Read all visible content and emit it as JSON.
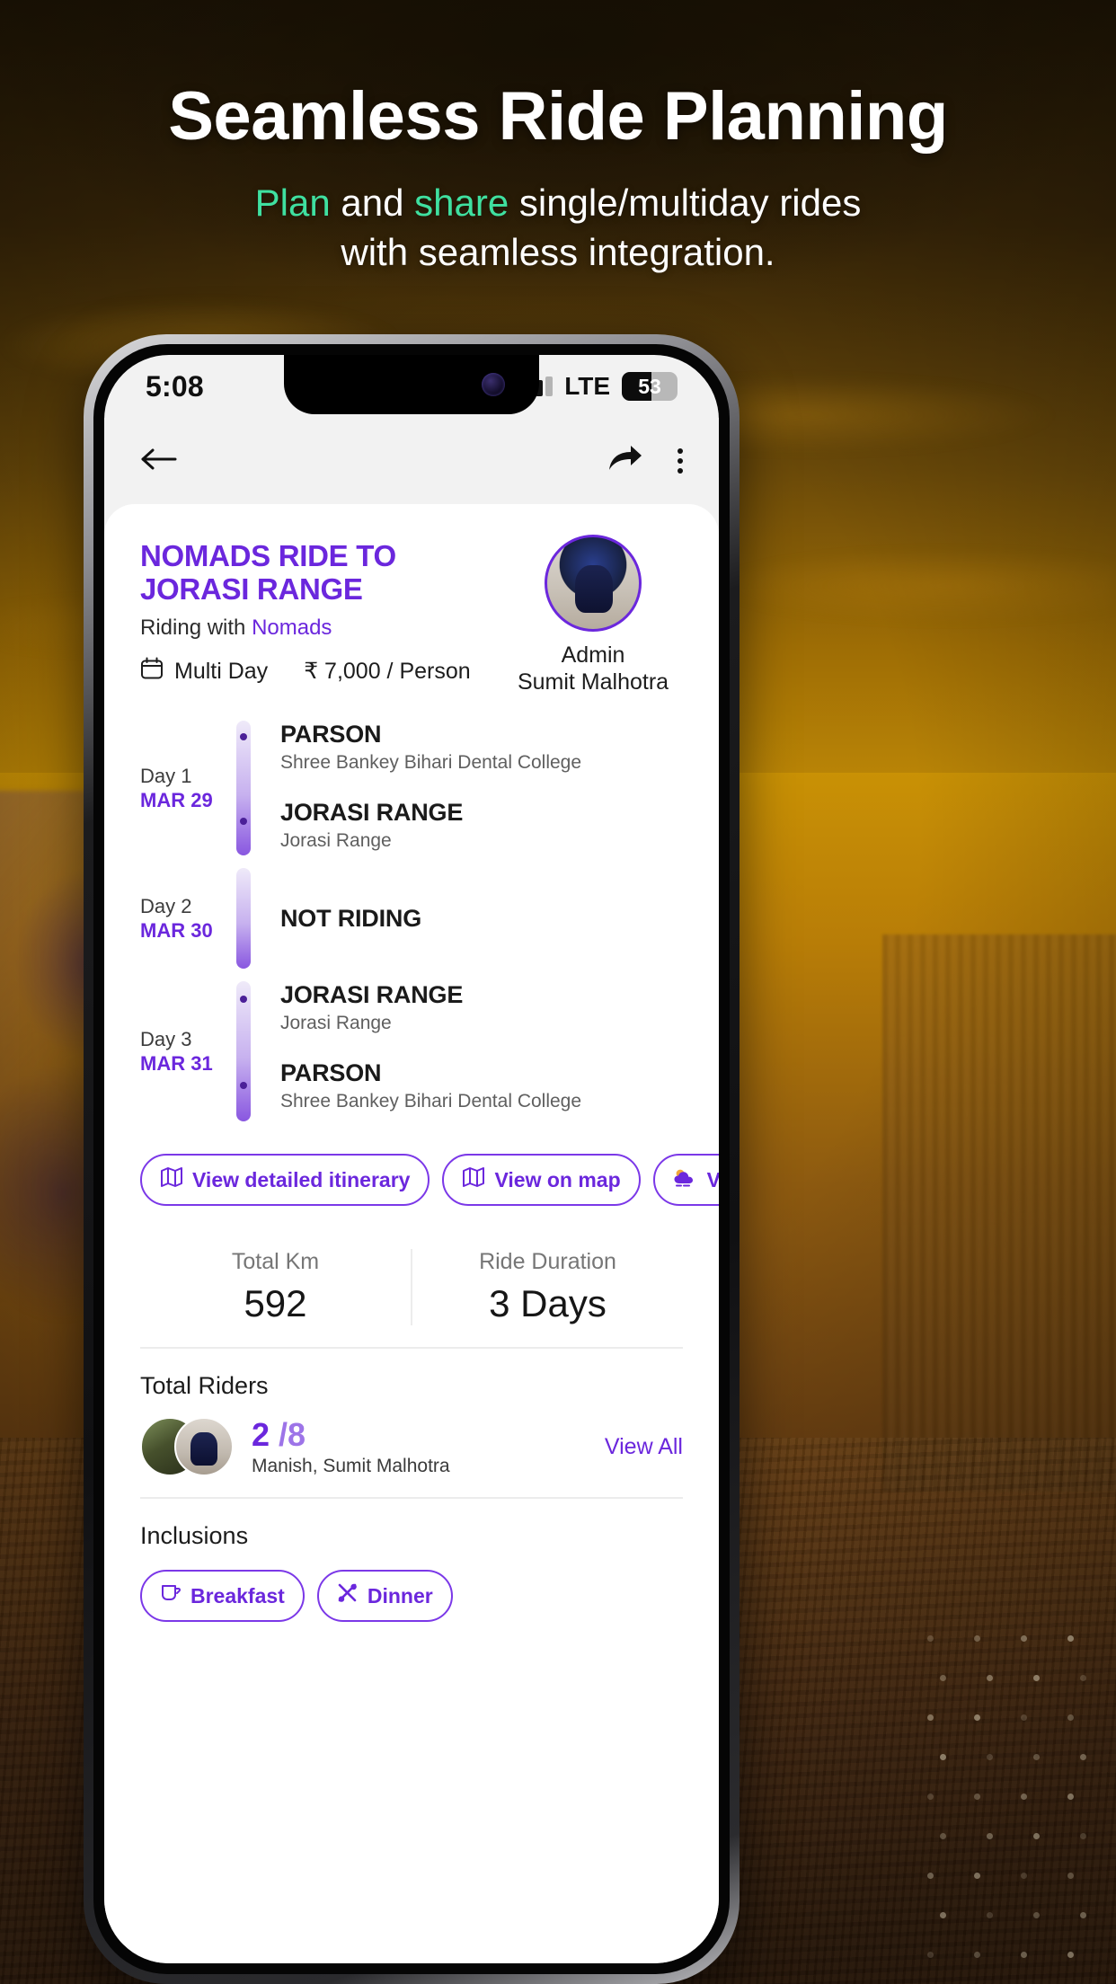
{
  "promo": {
    "title": "Seamless Ride Planning",
    "subtitle_parts": [
      {
        "text": "Plan",
        "accent": true
      },
      {
        "text": " and ",
        "accent": false
      },
      {
        "text": "share",
        "accent": true
      },
      {
        "text": " single/multiday rides",
        "accent": false
      }
    ],
    "subtitle_line1_a": "Plan",
    "subtitle_line1_b": " and ",
    "subtitle_line1_c": "share",
    "subtitle_line1_d": " single/multiday rides",
    "subtitle_line2": "with seamless integration.",
    "accent_color": "#3fe0a0",
    "title_color": "#ffffff"
  },
  "statusbar": {
    "time": "5:08",
    "network": "LTE",
    "battery_percent": "53",
    "signal_icon": "signal-bars-icon"
  },
  "appbar": {
    "back_icon": "arrow-left-icon",
    "share_icon": "share-arrow-icon",
    "more_icon": "more-vertical-icon"
  },
  "ride": {
    "title": "NOMADS RIDE TO JORASI RANGE",
    "riding_with_label": "Riding with",
    "organizer": "Nomads",
    "calendar_icon": "calendar-icon",
    "duration_type": "Multi Day",
    "price": "₹ 7,000 / Person",
    "accent_color": "#6b27dd"
  },
  "admin": {
    "role": "Admin",
    "name": "Sumit Malhotra",
    "avatar_icon": "admin-avatar"
  },
  "itinerary": {
    "days": [
      {
        "day": "Day 1",
        "date": "MAR 29",
        "stops": [
          {
            "name": "PARSON",
            "desc": "Shree Bankey Bihari Dental College"
          },
          {
            "name": "JORASI RANGE",
            "desc": "Jorasi Range"
          }
        ]
      },
      {
        "day": "Day 2",
        "date": "MAR 30",
        "stops": [
          {
            "name": "NOT RIDING",
            "desc": ""
          }
        ]
      },
      {
        "day": "Day 3",
        "date": "MAR 31",
        "stops": [
          {
            "name": "JORASI RANGE",
            "desc": "Jorasi Range"
          },
          {
            "name": "PARSON",
            "desc": "Shree Bankey Bihari Dental College"
          }
        ]
      }
    ]
  },
  "actions": [
    {
      "label": "View detailed itinerary",
      "icon": "map-book-icon"
    },
    {
      "label": "View on map",
      "icon": "map-book-icon"
    },
    {
      "label": "View weather",
      "icon": "cloud-weather-icon"
    }
  ],
  "stats": [
    {
      "label": "Total Km",
      "value": "592"
    },
    {
      "label": "Ride Duration",
      "value": "3 Days"
    }
  ],
  "riders": {
    "title": "Total Riders",
    "count": "2",
    "total": "/8",
    "names": "Manish, Sumit Malhotra",
    "view_all": "View All"
  },
  "inclusions": {
    "title": "Inclusions",
    "items": [
      {
        "label": "Breakfast",
        "icon": "cup-icon"
      },
      {
        "label": "Dinner",
        "icon": "fork-spoon-icon"
      }
    ]
  }
}
